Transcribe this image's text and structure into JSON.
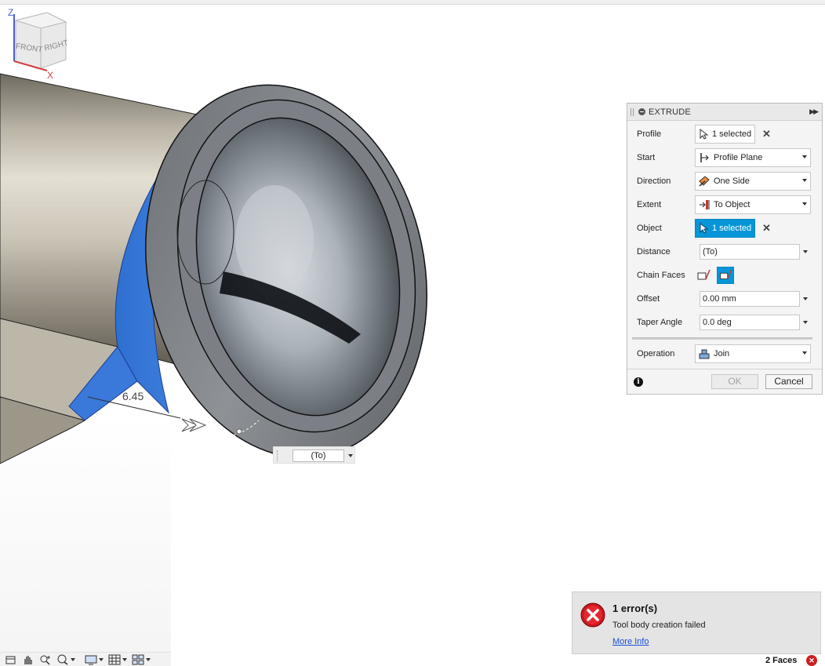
{
  "viewcube": {
    "axis_z": "Z",
    "axis_x": "X",
    "face_front": "FRONT",
    "face_right": "RIGHT"
  },
  "canvas": {
    "dimension_label": "6.45"
  },
  "inline_input": {
    "value": "(To)"
  },
  "extrude_panel": {
    "title": "EXTRUDE",
    "rows": {
      "profile": {
        "label": "Profile",
        "value": "1 selected"
      },
      "start": {
        "label": "Start",
        "value": "Profile Plane"
      },
      "direction": {
        "label": "Direction",
        "value": "One Side"
      },
      "extent": {
        "label": "Extent",
        "value": "To Object"
      },
      "object": {
        "label": "Object",
        "value": "1 selected"
      },
      "distance": {
        "label": "Distance",
        "value": "(To)"
      },
      "chain_faces": {
        "label": "Chain Faces"
      },
      "offset": {
        "label": "Offset",
        "value": "0.00 mm"
      },
      "taper_angle": {
        "label": "Taper Angle",
        "value": "0.0 deg"
      },
      "operation": {
        "label": "Operation",
        "value": "Join"
      }
    },
    "ok_label": "OK",
    "cancel_label": "Cancel",
    "colors": {
      "accent": "#0696d7"
    }
  },
  "toast": {
    "title": "1 error(s)",
    "message": "Tool body creation failed",
    "link": "More Info"
  },
  "status": {
    "selection": "2 Faces"
  },
  "bottom_toolbar": {
    "icons": [
      "save-view-icon",
      "pan-icon",
      "zoom-icon",
      "zoom-window-icon",
      "display-settings-icon",
      "grid-icon",
      "viewports-icon"
    ]
  }
}
